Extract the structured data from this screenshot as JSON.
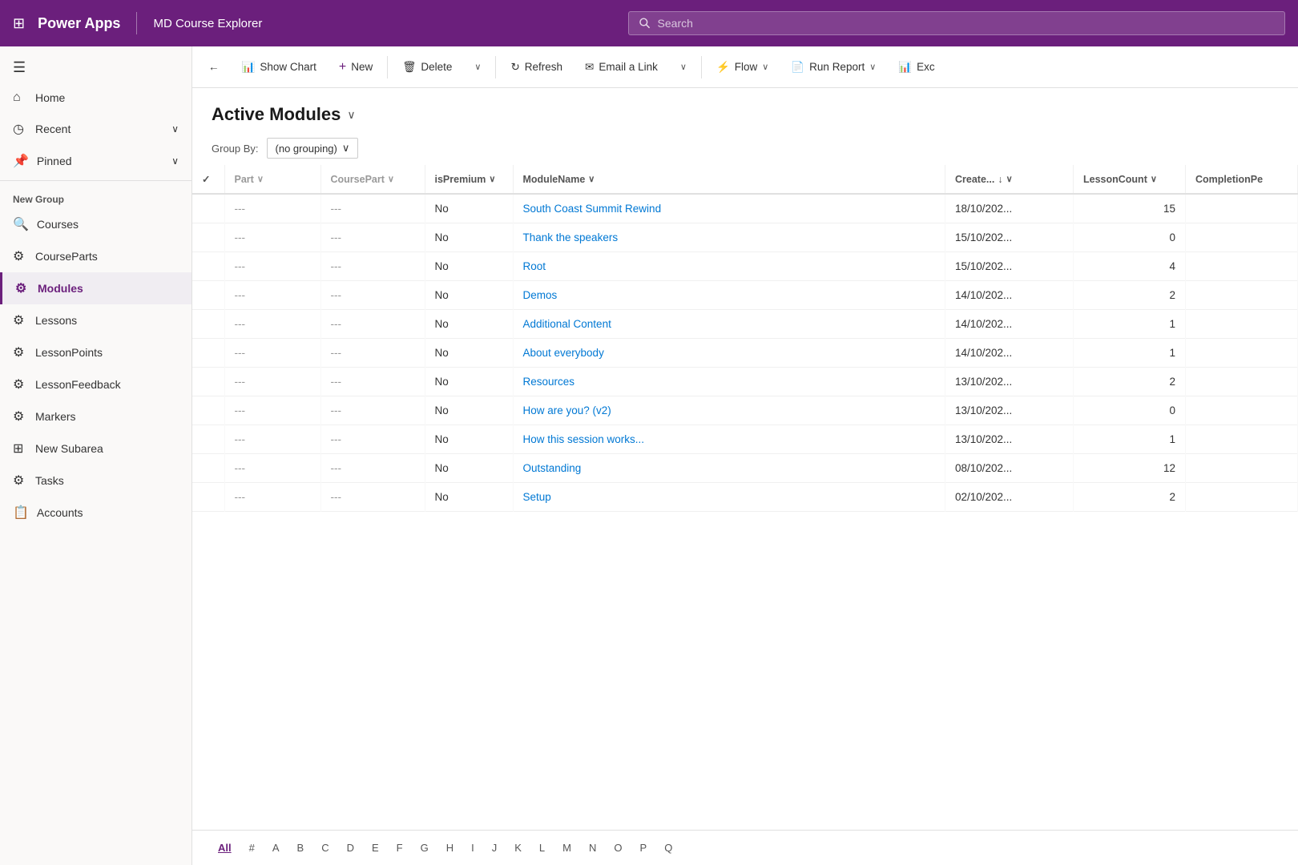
{
  "topbar": {
    "logo": "Power Apps",
    "app_name": "MD Course Explorer",
    "search_placeholder": "Search"
  },
  "sidebar": {
    "menu_icon": "≡",
    "items": [
      {
        "id": "home",
        "label": "Home",
        "icon": "⌂"
      },
      {
        "id": "recent",
        "label": "Recent",
        "icon": "◷",
        "has_chevron": true
      },
      {
        "id": "pinned",
        "label": "Pinned",
        "icon": "📌",
        "has_chevron": true
      }
    ],
    "section_label": "New Group",
    "nav_items": [
      {
        "id": "courses",
        "label": "Courses",
        "icon": "🔍"
      },
      {
        "id": "courseparts",
        "label": "CourseParts",
        "icon": "⚙"
      },
      {
        "id": "modules",
        "label": "Modules",
        "icon": "⚙",
        "active": true
      },
      {
        "id": "lessons",
        "label": "Lessons",
        "icon": "⚙"
      },
      {
        "id": "lessonpoints",
        "label": "LessonPoints",
        "icon": "⚙"
      },
      {
        "id": "lessonfeedback",
        "label": "LessonFeedback",
        "icon": "⚙"
      },
      {
        "id": "markers",
        "label": "Markers",
        "icon": "⚙"
      },
      {
        "id": "newsubarea",
        "label": "New Subarea",
        "icon": "⊞"
      },
      {
        "id": "tasks",
        "label": "Tasks",
        "icon": "⚙"
      },
      {
        "id": "accounts",
        "label": "Accounts",
        "icon": "📋"
      }
    ]
  },
  "commandbar": {
    "back_label": "←",
    "show_chart_label": "Show Chart",
    "new_label": "New",
    "delete_label": "Delete",
    "refresh_label": "Refresh",
    "email_link_label": "Email a Link",
    "flow_label": "Flow",
    "run_report_label": "Run Report",
    "excel_label": "Exc"
  },
  "page": {
    "title": "Active Modules",
    "groupby_label": "Group By:",
    "groupby_value": "(no grouping)"
  },
  "table": {
    "columns": [
      {
        "id": "check",
        "label": "✓"
      },
      {
        "id": "part",
        "label": "Part",
        "sortable": true
      },
      {
        "id": "coursepart",
        "label": "CoursePart",
        "sortable": true
      },
      {
        "id": "ispremium",
        "label": "isPremium",
        "sortable": true
      },
      {
        "id": "modulename",
        "label": "ModuleName",
        "sortable": true
      },
      {
        "id": "created",
        "label": "Create...",
        "sortable": true,
        "sorted": true,
        "sort_dir": "↓"
      },
      {
        "id": "lessoncount",
        "label": "LessonCount",
        "sortable": true
      },
      {
        "id": "completionpe",
        "label": "CompletionPe"
      }
    ],
    "rows": [
      {
        "part": "---",
        "coursepart": "---",
        "ispremium": "No",
        "modulename": "South Coast Summit Rewind",
        "created": "18/10/202...",
        "lessoncount": 15,
        "completionpe": ""
      },
      {
        "part": "---",
        "coursepart": "---",
        "ispremium": "No",
        "modulename": "Thank the speakers",
        "created": "15/10/202...",
        "lessoncount": 0,
        "completionpe": ""
      },
      {
        "part": "---",
        "coursepart": "---",
        "ispremium": "No",
        "modulename": "Root",
        "created": "15/10/202...",
        "lessoncount": 4,
        "completionpe": ""
      },
      {
        "part": "---",
        "coursepart": "---",
        "ispremium": "No",
        "modulename": "Demos",
        "created": "14/10/202...",
        "lessoncount": 2,
        "completionpe": ""
      },
      {
        "part": "---",
        "coursepart": "---",
        "ispremium": "No",
        "modulename": "Additional Content",
        "created": "14/10/202...",
        "lessoncount": 1,
        "completionpe": ""
      },
      {
        "part": "---",
        "coursepart": "---",
        "ispremium": "No",
        "modulename": "About everybody",
        "created": "14/10/202...",
        "lessoncount": 1,
        "completionpe": ""
      },
      {
        "part": "---",
        "coursepart": "---",
        "ispremium": "No",
        "modulename": "Resources",
        "created": "13/10/202...",
        "lessoncount": 2,
        "completionpe": ""
      },
      {
        "part": "---",
        "coursepart": "---",
        "ispremium": "No",
        "modulename": "How are you? (v2)",
        "created": "13/10/202...",
        "lessoncount": 0,
        "completionpe": ""
      },
      {
        "part": "---",
        "coursepart": "---",
        "ispremium": "No",
        "modulename": "How this session works...",
        "created": "13/10/202...",
        "lessoncount": 1,
        "completionpe": ""
      },
      {
        "part": "---",
        "coursepart": "---",
        "ispremium": "No",
        "modulename": "Outstanding",
        "created": "08/10/202...",
        "lessoncount": 12,
        "completionpe": ""
      },
      {
        "part": "---",
        "coursepart": "---",
        "ispremium": "No",
        "modulename": "Setup",
        "created": "02/10/202...",
        "lessoncount": 2,
        "completionpe": ""
      }
    ]
  },
  "pagination": {
    "letters": [
      "All",
      "#",
      "A",
      "B",
      "C",
      "D",
      "E",
      "F",
      "G",
      "H",
      "I",
      "J",
      "K",
      "L",
      "M",
      "N",
      "O",
      "P",
      "Q"
    ],
    "active": "All"
  },
  "colors": {
    "brand": "#6b1f7c",
    "active_border": "#6b1f7c"
  }
}
